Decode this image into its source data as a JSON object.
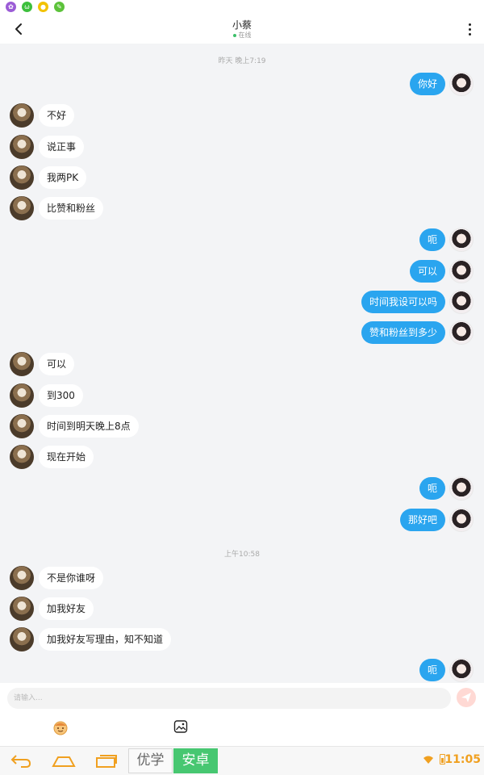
{
  "header": {
    "title": "小蔡",
    "status": "在线"
  },
  "chat": {
    "timestamps": [
      "昨天 晚上7:19",
      "上午10:58"
    ],
    "messages": [
      {
        "side": "self",
        "text": "你好"
      },
      {
        "side": "other",
        "text": "不好"
      },
      {
        "side": "other",
        "text": "说正事"
      },
      {
        "side": "other",
        "text": "我两PK"
      },
      {
        "side": "other",
        "text": "比赞和粉丝"
      },
      {
        "side": "self",
        "text": "呃"
      },
      {
        "side": "self",
        "text": "可以"
      },
      {
        "side": "self",
        "text": "时间我设可以吗"
      },
      {
        "side": "self",
        "text": "赞和粉丝到多少"
      },
      {
        "side": "other",
        "text": "可以"
      },
      {
        "side": "other",
        "text": "到300"
      },
      {
        "side": "other",
        "text": "时间到明天晚上8点"
      },
      {
        "side": "other",
        "text": "现在开始"
      },
      {
        "side": "self",
        "text": "呃"
      },
      {
        "side": "self",
        "text": "那好吧"
      },
      {
        "side": "other",
        "text": "不是你谁呀"
      },
      {
        "side": "other",
        "text": "加我好友"
      },
      {
        "side": "other",
        "text": "加我好友写理由，知不知道"
      },
      {
        "side": "self",
        "text": "呃"
      }
    ]
  },
  "input": {
    "placeholder": "请输入..."
  },
  "navbar": {
    "ime_label_1": "优学",
    "ime_label_2": "安卓",
    "time": "11:05"
  },
  "colors": {
    "self_bubble": "#2aa5ef",
    "accent_orange": "#f0a020",
    "ime_green": "#47c771"
  }
}
